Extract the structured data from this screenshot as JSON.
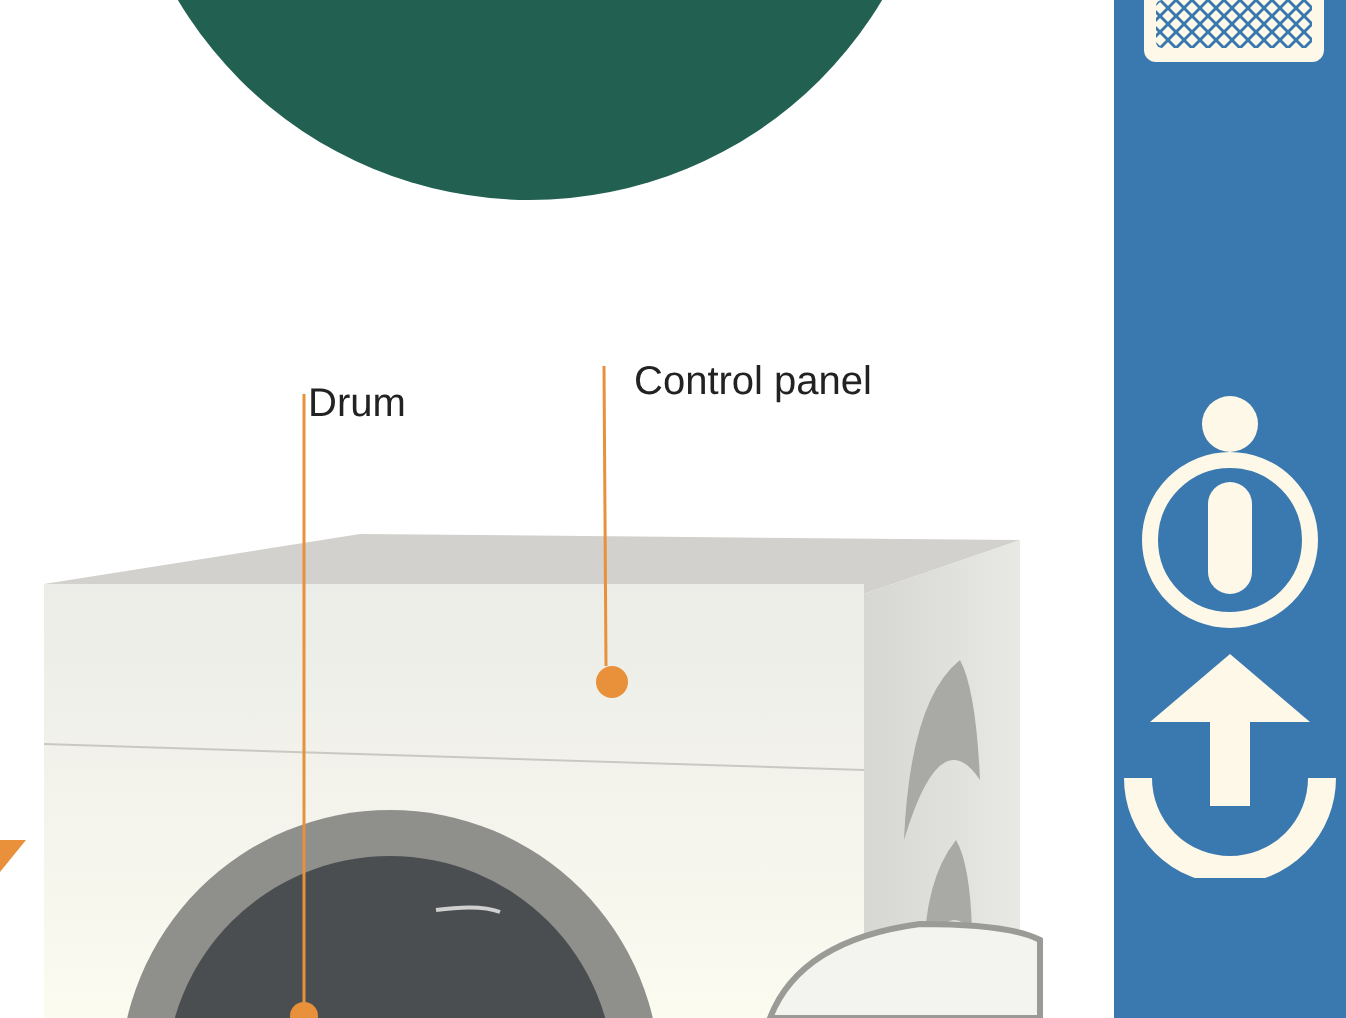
{
  "labels": [
    {
      "text": "Drum"
    },
    {
      "text": "Control panel"
    }
  ]
}
